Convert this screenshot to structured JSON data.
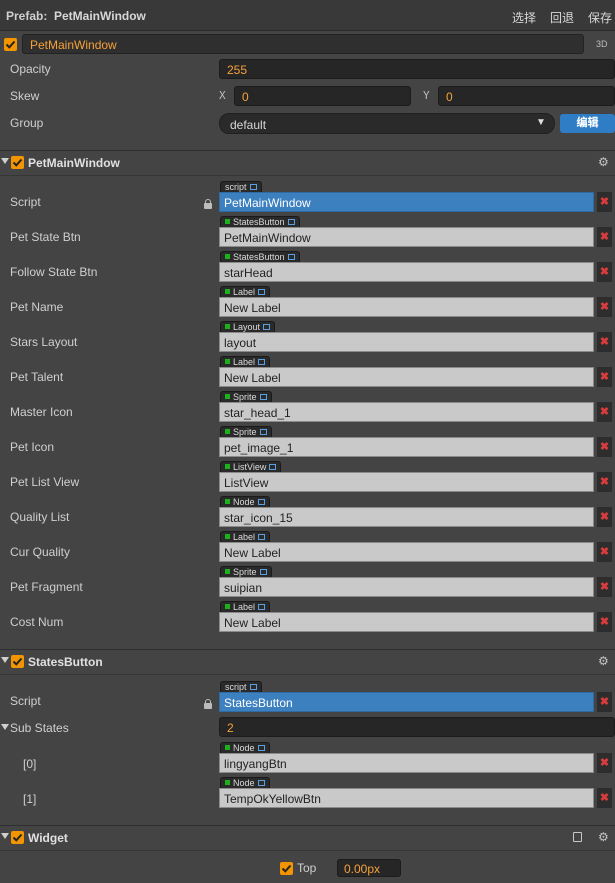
{
  "header": {
    "prefab_label": "Prefab:",
    "prefab_name": "PetMainWindow",
    "btn_select": "选择",
    "btn_revert": "回退",
    "btn_save": "保存"
  },
  "node": {
    "name": "PetMainWindow",
    "badge_3d": "3D"
  },
  "props": {
    "opacity": {
      "label": "Opacity",
      "value": "255"
    },
    "skew": {
      "label": "Skew",
      "x_label": "X",
      "x": "0",
      "y_label": "Y",
      "y": "0"
    },
    "group": {
      "label": "Group",
      "value": "default",
      "edit": "编辑"
    }
  },
  "pet_main": {
    "title": "PetMainWindow",
    "rows": [
      {
        "label": "Script",
        "tag": "script",
        "value": "PetMainWindow"
      },
      {
        "label": "Pet State Btn",
        "tag": "StatesButton",
        "value": "PetMainWindow"
      },
      {
        "label": "Follow State Btn",
        "tag": "StatesButton",
        "value": "starHead"
      },
      {
        "label": "Pet Name",
        "tag": "Label",
        "value": "New Label"
      },
      {
        "label": "Stars Layout",
        "tag": "Layout",
        "value": "layout"
      },
      {
        "label": "Pet Talent",
        "tag": "Label",
        "value": "New Label"
      },
      {
        "label": "Master Icon",
        "tag": "Sprite",
        "value": "star_head_1"
      },
      {
        "label": "Pet Icon",
        "tag": "Sprite",
        "value": "pet_image_1"
      },
      {
        "label": "Pet List View",
        "tag": "ListView",
        "value": "ListView"
      },
      {
        "label": "Quality List",
        "tag": "Node",
        "value": "star_icon_15"
      },
      {
        "label": "Cur Quality",
        "tag": "Label",
        "value": "New Label"
      },
      {
        "label": "Pet Fragment",
        "tag": "Sprite",
        "value": "suipian"
      },
      {
        "label": "Cost Num",
        "tag": "Label",
        "value": "New Label"
      }
    ]
  },
  "states_button": {
    "title": "StatesButton",
    "script": {
      "label": "Script",
      "tag": "script",
      "value": "StatesButton"
    },
    "sub_states": {
      "label": "Sub States",
      "count": "2"
    },
    "items": [
      {
        "label": "[0]",
        "tag": "Node",
        "value": "lingyangBtn"
      },
      {
        "label": "[1]",
        "tag": "Node",
        "value": "TempOkYellowBtn"
      }
    ]
  },
  "widget": {
    "title": "Widget",
    "top_label": "Top",
    "top_value": "0.00px"
  },
  "icons": {
    "check": "checkmark-icon",
    "gear": "gear-icon",
    "lock": "lock-icon",
    "remove": "remove-x-icon",
    "collapse": "collapse-triangle-icon",
    "book": "book-icon",
    "dropdown": "dropdown-arrow-icon"
  },
  "colors": {
    "accent": "#f29500",
    "selected_field": "#3d80c0",
    "remove": "#d83c3c",
    "edit_button": "#2f7ec5"
  }
}
